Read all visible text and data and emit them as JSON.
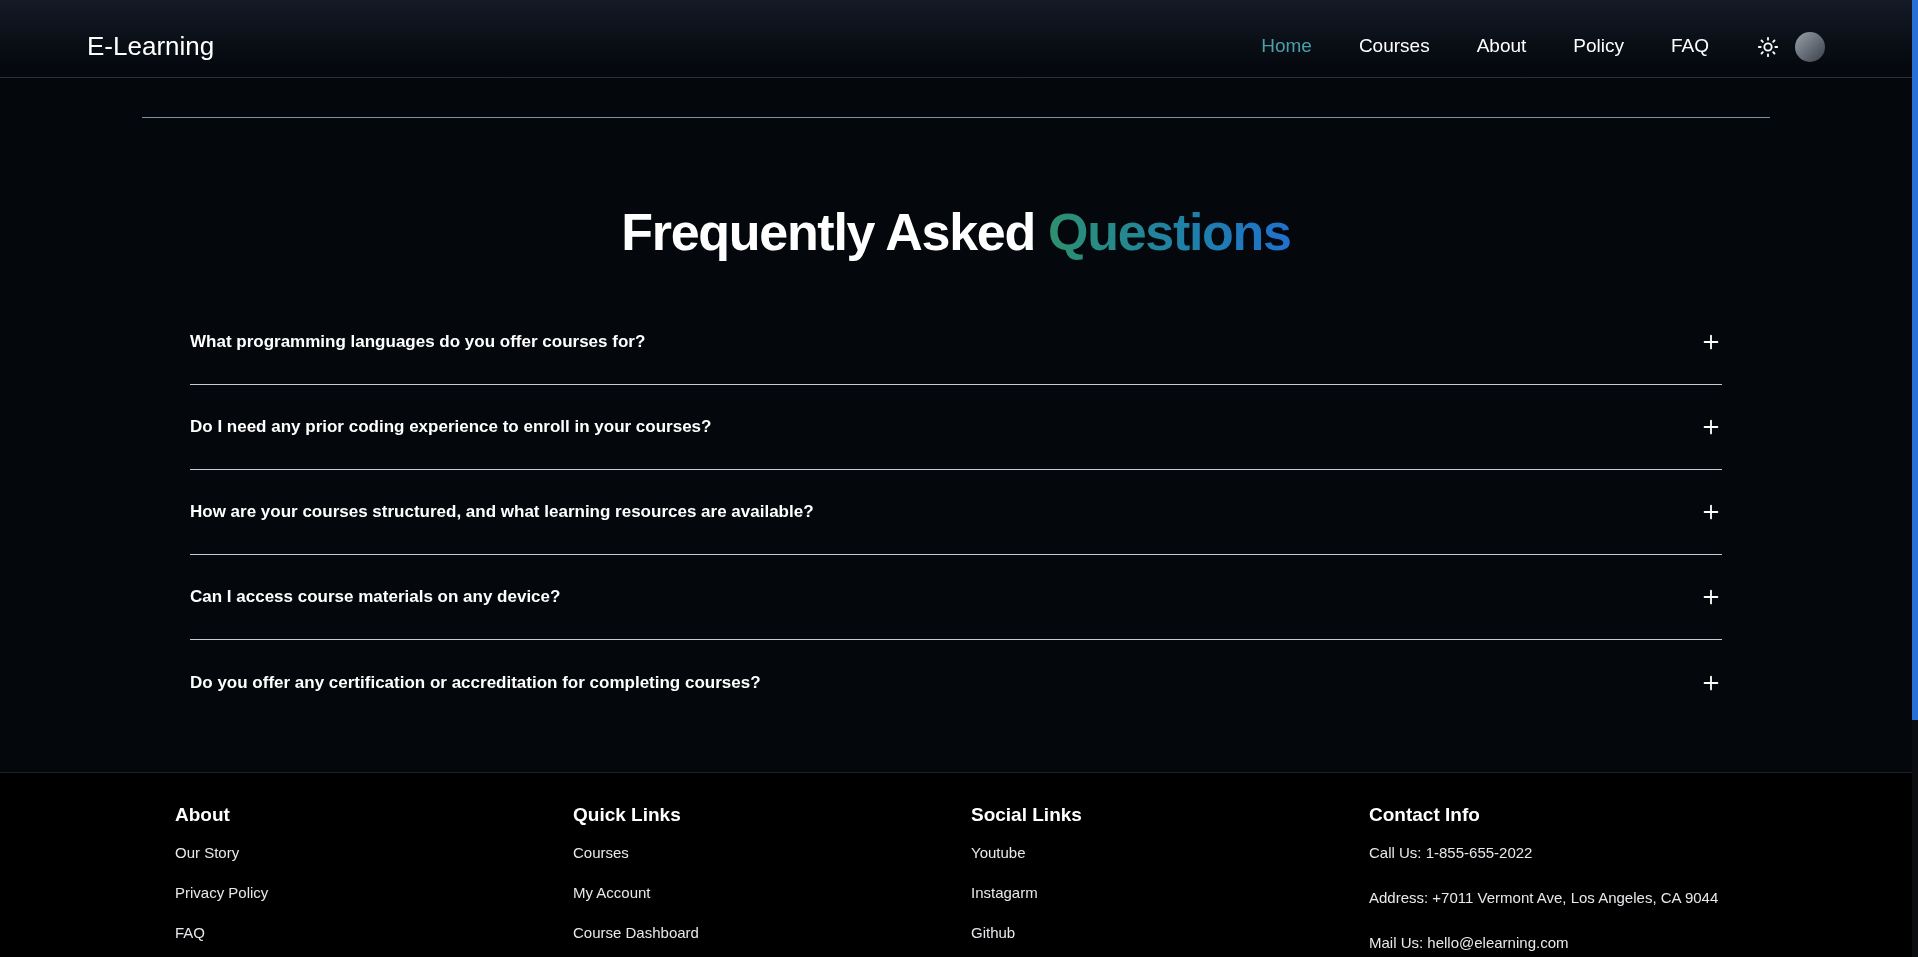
{
  "header": {
    "logo": "E-Learning",
    "nav": [
      {
        "label": "Home",
        "selected": true
      },
      {
        "label": "Courses",
        "selected": false
      },
      {
        "label": "About",
        "selected": false
      },
      {
        "label": "Policy",
        "selected": false
      },
      {
        "label": "FAQ",
        "selected": false
      }
    ]
  },
  "faq": {
    "title": "Frequently Asked",
    "title_accent": "Questions",
    "items": [
      {
        "question": "What programming languages do you offer courses for?",
        "expanded": false
      },
      {
        "question": "Do I need any prior coding experience to enroll in your courses?",
        "expanded": false
      },
      {
        "question": "How are your courses structured, and what learning resources are available?",
        "expanded": false
      },
      {
        "question": "Can I access course materials on any device?",
        "expanded": false
      },
      {
        "question": "Do you offer any certification or accreditation for completing courses?",
        "expanded": false
      }
    ]
  },
  "footer": {
    "columns": [
      {
        "heading": "About",
        "links": [
          "Our Story",
          "Privacy Policy",
          "FAQ"
        ]
      },
      {
        "heading": "Quick Links",
        "links": [
          "Courses",
          "My Account",
          "Course Dashboard"
        ]
      },
      {
        "heading": "Social Links",
        "links": [
          "Youtube",
          "Instagarm",
          "Github"
        ]
      },
      {
        "heading": "Contact Info",
        "kind": "contact",
        "links": [
          "Call Us: 1-855-655-2022",
          "Address: +7011 Vermont Ave, Los Angeles, CA 9044",
          "Mail Us: hello@elearning.com"
        ]
      }
    ]
  }
}
